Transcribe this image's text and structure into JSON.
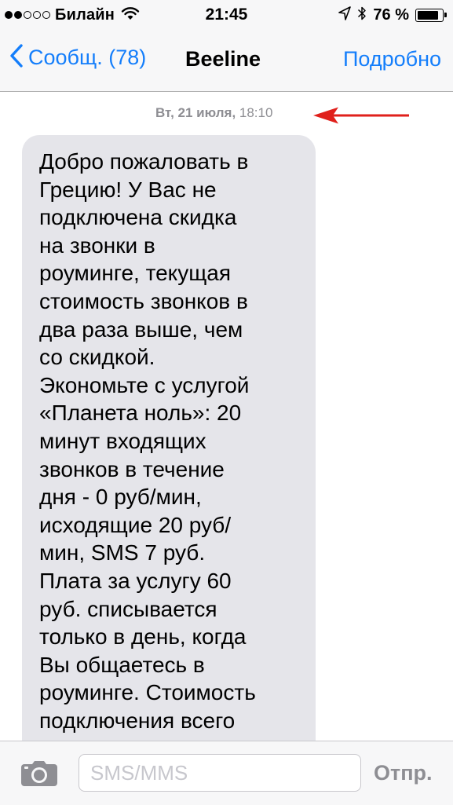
{
  "status_bar": {
    "signal_dots_filled": 2,
    "signal_dots_total": 5,
    "carrier": "Билайн",
    "time": "21:45",
    "battery_percent_label": "76 %",
    "battery_level": 0.76,
    "icons": [
      "wifi-icon",
      "location-icon",
      "bluetooth-icon",
      "battery-icon"
    ]
  },
  "nav": {
    "back_label": "Сообщ. (78)",
    "title": "Beeline",
    "details_label": "Подробно",
    "accent_color": "#147efb"
  },
  "conversation": {
    "timestamp_date": "Вт, 21 июля,",
    "timestamp_time": " 18:10",
    "annotation_arrow_color": "#e0201b",
    "messages": [
      {
        "sender": "Beeline",
        "text": "Добро пожаловать в\nГрецию! У Вас не\nподключена скидка\nна звонки в\nроуминге, текущая\nстоимость звонков в\nдва раза выше, чем\nсо скидкой.\nЭкономьте с услугой\n«Планета ноль»: 20\nминут входящих\nзвонков в течение\nдня - 0 руб/мин,\nисходящие 20 руб/\nмин, SMS 7 руб.\nПлата за услугу 60\nруб. списывается\nтолько в день, когда\nВы общаетесь в\nроуминге. Стоимость\nподключения всего"
      }
    ]
  },
  "composer": {
    "placeholder": "SMS/MMS",
    "value": "",
    "send_label": "Отпр."
  }
}
